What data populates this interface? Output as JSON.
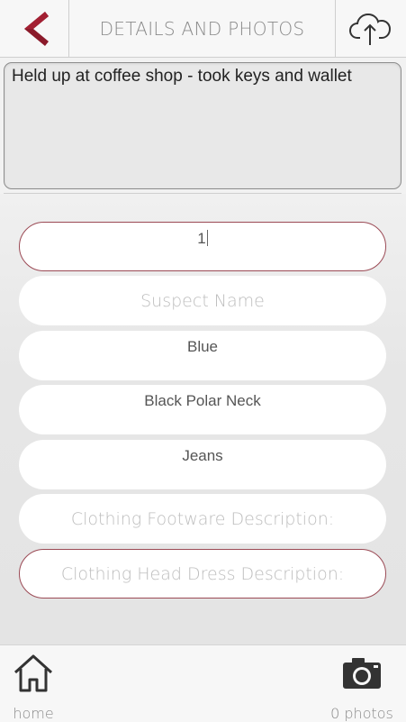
{
  "header": {
    "title": "DETAILS AND PHOTOS",
    "back_icon": "chevron-left-icon",
    "upload_icon": "cloud-upload-icon",
    "accent_color": "#8b1a2a"
  },
  "details": {
    "value": "Held up at coffee shop - took keys and wallet"
  },
  "form": {
    "field_1_value": "1",
    "suspect_name_placeholder": "Suspect Name",
    "field_3_value": "Blue",
    "field_4_value": "Black Polar Neck",
    "field_5_value": "Jeans",
    "footwear_placeholder": "Clothing Footware Description:",
    "head_dress_placeholder": "Clothing Head Dress Description:"
  },
  "bottom_bar": {
    "home_label": "home",
    "photos_label": "0 photos",
    "home_icon": "home-icon",
    "camera_icon": "camera-icon"
  }
}
